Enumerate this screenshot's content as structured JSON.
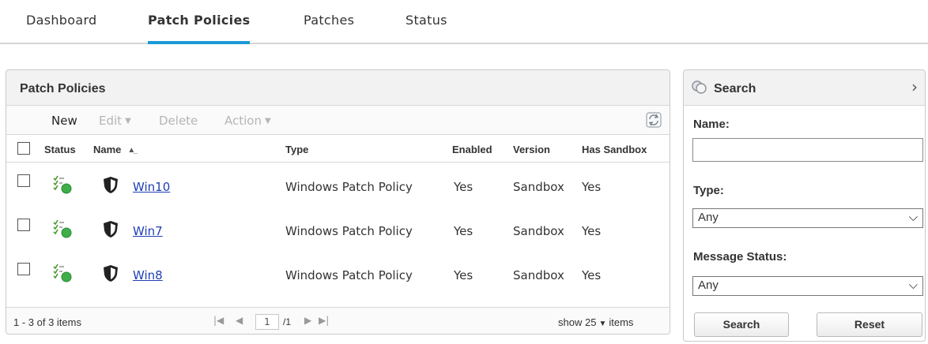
{
  "nav": {
    "tabs": [
      {
        "label": "Dashboard",
        "active": false
      },
      {
        "label": "Patch Policies",
        "active": true
      },
      {
        "label": "Patches",
        "active": false
      },
      {
        "label": "Status",
        "active": false
      }
    ],
    "accent_color": "#1b9ad6"
  },
  "policies_panel": {
    "title": "Patch Policies",
    "toolbar": {
      "new_label": "New",
      "edit_label": "Edit",
      "delete_label": "Delete",
      "action_label": "Action"
    },
    "columns": [
      "Status",
      "Name",
      "Type",
      "Enabled",
      "Version",
      "Has Sandbox"
    ],
    "sort": {
      "column": "Name",
      "direction": "ascending"
    },
    "rows": [
      {
        "name": "Win10",
        "type": "Windows Patch Policy",
        "enabled": "Yes",
        "version": "Sandbox",
        "has_sandbox": "Yes"
      },
      {
        "name": "Win7",
        "type": "Windows Patch Policy",
        "enabled": "Yes",
        "version": "Sandbox",
        "has_sandbox": "Yes"
      },
      {
        "name": "Win8",
        "type": "Windows Patch Policy",
        "enabled": "Yes",
        "version": "Sandbox",
        "has_sandbox": "Yes"
      }
    ],
    "footer": {
      "range_text": "1 - 3 of 3 items",
      "current_page": "1",
      "total_pages": "/1",
      "show_label": "show",
      "page_size": "25",
      "items_label": "items"
    }
  },
  "search_panel": {
    "title": "Search",
    "name_label": "Name:",
    "name_value": "",
    "type_label": "Type:",
    "type_value": "Any",
    "message_status_label": "Message Status:",
    "message_status_value": "Any",
    "search_button": "Search",
    "reset_button": "Reset"
  }
}
